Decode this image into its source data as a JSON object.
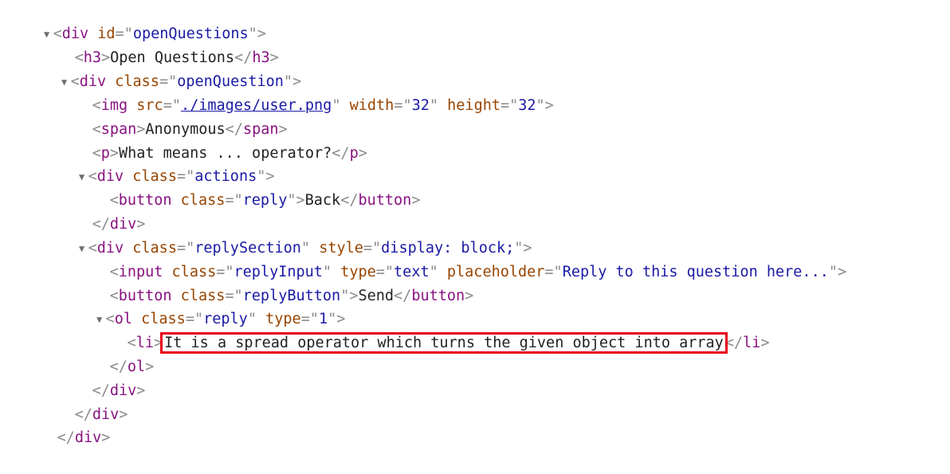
{
  "lines": [
    {
      "name": "root-div-open",
      "tag": "div",
      "attr": "id",
      "val": "openQuestions"
    },
    {
      "name": "h3-line",
      "open": "h3",
      "text": "Open Questions",
      "close": "h3"
    },
    {
      "name": "question-div-open",
      "tag": "div",
      "attr": "class",
      "val": "openQuestion"
    },
    {
      "name": "img-line",
      "tag": "img",
      "attr1": "src",
      "val1": "./images/user.png",
      "attr2": "width",
      "val2": "32",
      "attr3": "height",
      "val3": "32"
    },
    {
      "name": "span-line",
      "open": "span",
      "text": "Anonymous",
      "close": "span"
    },
    {
      "name": "p-line",
      "open": "p",
      "text": "What means ... operator?",
      "close": "p"
    },
    {
      "name": "actions-div-open",
      "tag": "div",
      "attr": "class",
      "val": "actions"
    },
    {
      "name": "back-button-line",
      "tag": "button",
      "attr": "class",
      "val": "reply",
      "text": "Back",
      "close": "button"
    },
    {
      "name": "actions-div-close",
      "close": "div"
    },
    {
      "name": "reply-section-open",
      "tag": "div",
      "attr1": "class",
      "val1": "replySection",
      "attr2": "style",
      "val2": "display: block;"
    },
    {
      "name": "reply-input-line",
      "tag": "input",
      "attr1": "class",
      "val1": "replyInput",
      "attr2": "type",
      "val2": "text",
      "attr3": "placeholder",
      "val3": "Reply to this question here..."
    },
    {
      "name": "send-button-line",
      "tag": "button",
      "attr": "class",
      "val": "replyButton",
      "text": "Send",
      "close": "button"
    },
    {
      "name": "ol-open",
      "tag": "ol",
      "attr1": "class",
      "val1": "reply",
      "attr2": "type",
      "val2": "1"
    },
    {
      "name": "li-line",
      "open": "li",
      "text": "It is a spread operator which turns the given object into array",
      "close": "li"
    },
    {
      "name": "ol-close",
      "close": "ol"
    },
    {
      "name": "reply-section-close",
      "close": "div"
    },
    {
      "name": "question-div-close",
      "close": "div"
    },
    {
      "name": "root-div-close",
      "close": "div"
    }
  ],
  "icons": {
    "expanded": "▼"
  },
  "colors": {
    "tag": "#881280",
    "attribute": "#994500",
    "value": "#1a1aa6",
    "punctuation": "#8b8b8b",
    "highlight": "#e8001c"
  }
}
